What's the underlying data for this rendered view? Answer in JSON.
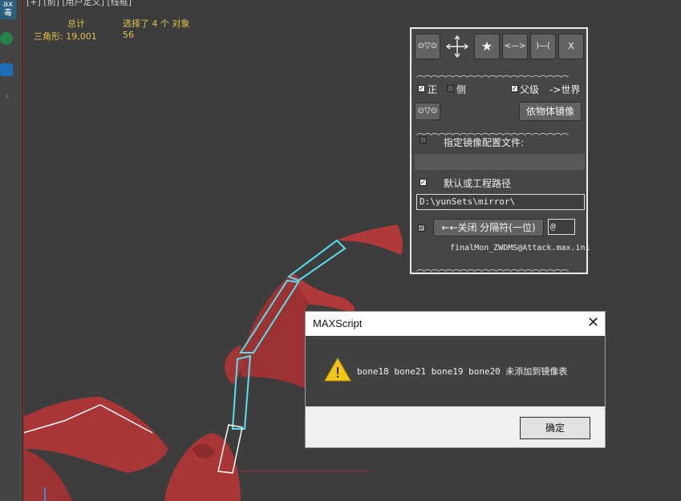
{
  "toolbar": {
    "top_label": "ax\n毒",
    "icons": [
      "app-icon",
      "green-circle-icon",
      "shield-icon",
      "chevron-right-icon"
    ]
  },
  "viewport": {
    "label": "[+] [前] [用户定义] [线框]",
    "stats": {
      "header_total": "总计",
      "header_selected": "选择了 4 个 对象",
      "row_label": "三角形:",
      "row_total": "19,001",
      "row_selected": "56"
    }
  },
  "mirror_panel": {
    "top_buttons": [
      "⊙▽⊙",
      "",
      "★",
      "<—>",
      ")—(",
      "X"
    ],
    "wave": "︵︵︵︵︵︵︵︵︵︵︵︵︵︵︵︵︵︵︵︵︵",
    "check_front": "正",
    "check_side": "侧",
    "check_parent": "父级",
    "world_label": "->世界",
    "small_btn": "⊙▽⊙",
    "mirror_by_object_btn": "依物体镜像",
    "specify_config_label": "指定镜像配置文件:",
    "config_path_value": "",
    "default_path_label": "默认或工程路径",
    "path_value": "D:\\yunSets\\mirror\\",
    "close_btn": "←←关闭 分隔符(一位)",
    "separator_value": "@",
    "filename": "finalMon_ZWDMS@Attack.max.ini"
  },
  "dialog": {
    "title": "MAXScript",
    "message": "bone18  bone21  bone19  bone20  未添加到镜像表",
    "ok_label": "确定",
    "close_icon": "close-icon",
    "warning_icon": "warning-icon"
  },
  "colors": {
    "viewport_bg": "#3d3d3d",
    "stats_text": "#e1c34a",
    "bone_outline": "#55e1ee",
    "dragon": "#b0393a"
  }
}
